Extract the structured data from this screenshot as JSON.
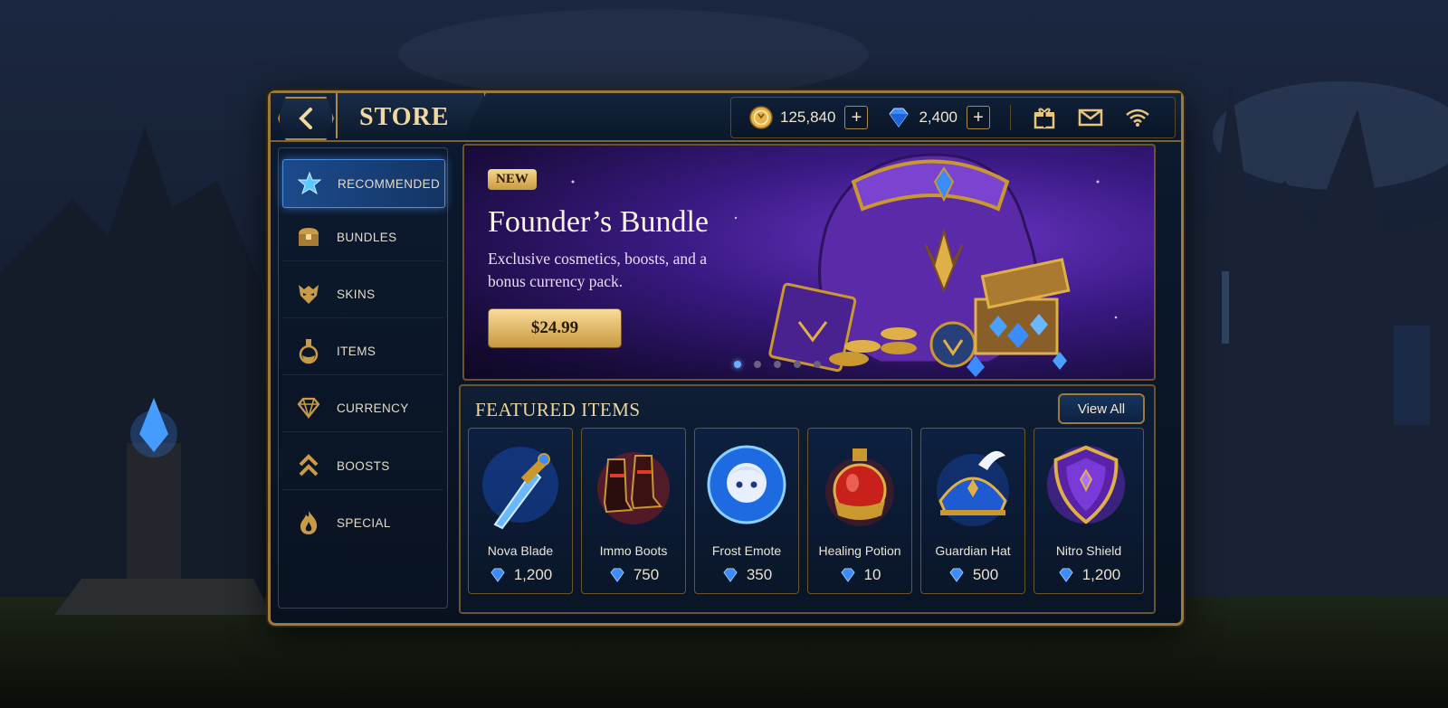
{
  "header": {
    "title": "STORE",
    "gold": "125,840",
    "gems": "2,400"
  },
  "sidebar": {
    "items": [
      {
        "label": "RECOMMENDED",
        "icon": "star-emblem-icon"
      },
      {
        "label": "BUNDLES",
        "icon": "chest-icon"
      },
      {
        "label": "SKINS",
        "icon": "mask-icon"
      },
      {
        "label": "ITEMS",
        "icon": "potion-icon"
      },
      {
        "label": "CURRENCY",
        "icon": "diamond-icon"
      },
      {
        "label": "BOOSTS",
        "icon": "chevrons-up-icon"
      },
      {
        "label": "SPECIAL",
        "icon": "flame-icon"
      }
    ]
  },
  "banner": {
    "badge": "NEW",
    "title": "Founder’s Bundle",
    "description": "Exclusive cosmetics, boosts, and a bonus currency pack.",
    "price": "$24.99"
  },
  "featured": {
    "title": "FEATURED ITEMS",
    "view_all": "View All",
    "items": [
      {
        "name": "Nova Blade",
        "price": "1,200"
      },
      {
        "name": "Immo Boots",
        "price": "750"
      },
      {
        "name": "Frost Emote",
        "price": "350"
      },
      {
        "name": "Healing Potion",
        "price": "10"
      },
      {
        "name": "Guardian Hat",
        "price": "500"
      },
      {
        "name": "Nitro Shield",
        "price": "1,200"
      }
    ]
  },
  "colors": {
    "gold_trim": "#b08a45",
    "active_blue": "#1d4a8c",
    "banner_purple": "#6a34c4",
    "gem_blue": "#3a8cff"
  }
}
